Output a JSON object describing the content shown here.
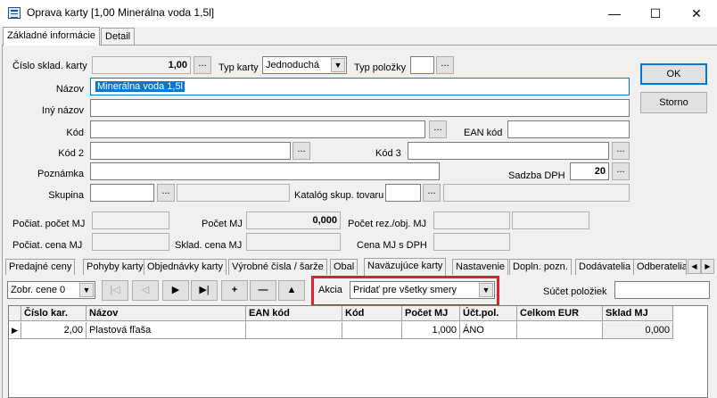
{
  "window": {
    "title": "Oprava karty [1,00  Minerálna voda 1,5l]",
    "minimize": "—",
    "maximize": "☐",
    "close": "✕"
  },
  "top_tabs": [
    "Základné informácie",
    "Detail"
  ],
  "form": {
    "cislo_label": "Číslo sklad. karty",
    "cislo_value": "1,00",
    "typ_karty_label": "Typ karty",
    "typ_karty_value": "Jednoduchá",
    "typ_polozky_label": "Typ položky",
    "typ_polozky_value": "",
    "nazov_label": "Názov",
    "nazov_value": "Minerálna voda 1,5l",
    "iny_nazov_label": "Iný názov",
    "iny_nazov_value": "",
    "kod_label": "Kód",
    "kod_value": "",
    "ean_label": "EAN kód",
    "ean_value": "",
    "kod2_label": "Kód 2",
    "kod2_value": "",
    "kod3_label": "Kód 3",
    "kod3_value": "",
    "poznamka_label": "Poznámka",
    "poznamka_value": "",
    "sadzba_label": "Sadzba DPH",
    "sadzba_value": "20",
    "skupina_label": "Skupina",
    "skupina_value": "",
    "katalog_label": "Katalóg skup. tovaru",
    "katalog_value": "",
    "poc_pocet_label": "Počiat. počet MJ",
    "poc_pocet_value": "",
    "pocet_mj_label": "Počet MJ",
    "pocet_mj_value": "0,000",
    "pocet_rez_label": "Počet rez./obj. MJ",
    "pocet_rez_value": "",
    "poc_cena_label": "Počiat. cena MJ",
    "poc_cena_value": "",
    "sklad_cena_label": "Sklad. cena MJ",
    "sklad_cena_value": "",
    "cena_dph_label": "Cena MJ s DPH",
    "cena_dph_value": "",
    "ellipsis": "..."
  },
  "buttons": {
    "ok": "OK",
    "storno": "Storno"
  },
  "sub_tabs": [
    "Predajné ceny",
    "Pohyby karty",
    "Objednávky karty",
    "Výrobné čísla / šarže",
    "Obal",
    "Naväzujúce karty",
    "Nastavenie",
    "Dopln. pozn.",
    "Dodávatelia",
    "Odberatelia"
  ],
  "toolbar": {
    "zobr_value": "Zobr. cene 0",
    "nav": [
      "|◁",
      "◁",
      "▶",
      "▶|",
      "+",
      "—",
      "▲"
    ],
    "akcia_label": "Akcia",
    "akcia_value": "Pridať pre všetky smery",
    "sucet_label": "Súčet položiek",
    "sucet_value": ""
  },
  "grid": {
    "headers": [
      "Číslo kar.",
      "Názov",
      "EAN kód",
      "Kód",
      "Počet MJ",
      "Účt.pol.",
      "Celkom EUR",
      "Sklad MJ"
    ],
    "rows": [
      [
        "2,00",
        "Plastová fľaša",
        "",
        "",
        "1,000",
        "ÁNO",
        "",
        "0,000"
      ]
    ]
  }
}
